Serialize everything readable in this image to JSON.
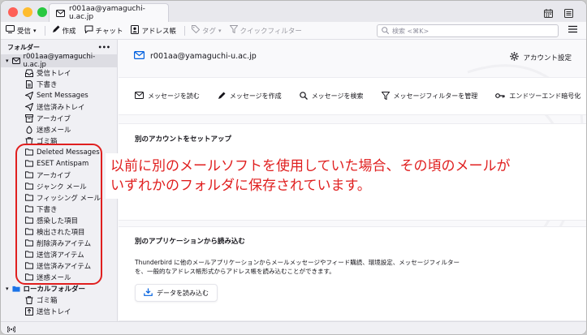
{
  "tab": {
    "title": "r001aa@yamaguchi-u.ac.jp"
  },
  "toolbar": {
    "get_mail": "受信",
    "write": "作成",
    "chat": "チャット",
    "address_book": "アドレス帳",
    "tag": "タグ",
    "quick_filter": "クイックフィルター",
    "search_placeholder": "検索 <⌘K>"
  },
  "sidebar": {
    "header": "フォルダー",
    "more": "•••",
    "account": "r001aa@yamaguchi-u.ac.jp",
    "account_folders": [
      {
        "label": "受信トレイ",
        "icon": "inbox-icon"
      },
      {
        "label": "下書き",
        "icon": "draft-icon"
      },
      {
        "label": "Sent Messages",
        "icon": "sent-icon"
      },
      {
        "label": "送信済みトレイ",
        "icon": "sent-icon"
      },
      {
        "label": "アーカイブ",
        "icon": "archive-icon"
      },
      {
        "label": "迷惑メール",
        "icon": "junk-icon"
      },
      {
        "label": "ゴミ箱",
        "icon": "trash-icon"
      },
      {
        "label": "Deleted Messages",
        "icon": "folder-icon"
      },
      {
        "label": "ESET Antispam",
        "icon": "folder-icon"
      },
      {
        "label": "アーカイブ",
        "icon": "folder-icon"
      },
      {
        "label": "ジャンク メール",
        "icon": "folder-icon"
      },
      {
        "label": "フィッシング メール",
        "icon": "folder-icon"
      },
      {
        "label": "下書き",
        "icon": "folder-icon"
      },
      {
        "label": "感染した項目",
        "icon": "folder-icon"
      },
      {
        "label": "検出された項目",
        "icon": "folder-icon"
      },
      {
        "label": "削除済みアイテム",
        "icon": "folder-icon"
      },
      {
        "label": "送信済アイテム",
        "icon": "folder-icon"
      },
      {
        "label": "送信済みアイテム",
        "icon": "folder-icon"
      },
      {
        "label": "迷惑メール",
        "icon": "folder-icon"
      }
    ],
    "local_folders": "ローカルフォルダー",
    "local_items": [
      {
        "label": "ゴミ箱",
        "icon": "trash-icon"
      },
      {
        "label": "送信トレイ",
        "icon": "outbox-icon"
      }
    ]
  },
  "main": {
    "account_title": "r001aa@yamaguchi-u.ac.jp",
    "account_settings": "アカウント設定",
    "actions": [
      "メッセージを読む",
      "メッセージを作成",
      "メッセージを検索",
      "メッセージフィルターを管理",
      "エンドツーエンド暗号化"
    ],
    "setup_title": "別のアカウントをセットアップ",
    "import_title": "別のアプリケーションから読み込む",
    "import_desc": "Thunderbird に他のメールアプリケーションからメールメッセージやフィード購読、環境設定、メッセージフィルターを、一般的なアドレス帳形式からアドレス帳を読み込むことができます。",
    "import_button": "データを読み込む"
  },
  "annotation": {
    "line1": "以前に別のメールソフトを使用していた場合、その頃のメールが",
    "line2": "いずれかのフォルダに保存されています。",
    "color": "#e01f1f"
  },
  "colors": {
    "accent": "#0060df",
    "annotation": "#e01f1f"
  }
}
